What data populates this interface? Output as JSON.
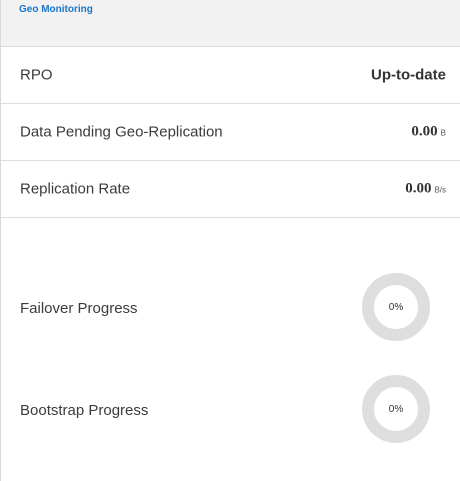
{
  "panel": {
    "title": "Geo Monitoring"
  },
  "rows": [
    {
      "label": "RPO",
      "value": "Up-to-date",
      "unit": ""
    },
    {
      "label": "Data Pending Geo-Replication",
      "value": "0.00",
      "unit": "B"
    },
    {
      "label": "Replication Rate",
      "value": "0.00",
      "unit": "B/s"
    }
  ],
  "progress": [
    {
      "label": "Failover Progress",
      "value_text": "0%",
      "percent": 0
    },
    {
      "label": "Bootstrap Progress",
      "value_text": "0%",
      "percent": 0
    }
  ],
  "colors": {
    "title": "#1a74c9",
    "donut_track": "#dedede",
    "donut_fill": "#1a74c9"
  }
}
